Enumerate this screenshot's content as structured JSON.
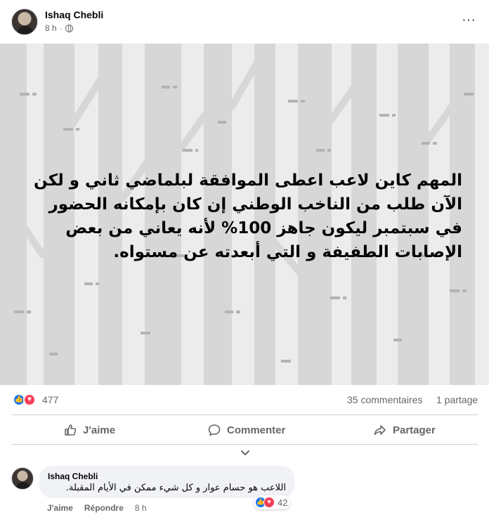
{
  "post": {
    "author": "Ishaq Chebli",
    "time": "8 h",
    "separator": "·",
    "more_icon": "⋯",
    "text": "المهم كاين لاعب اعطى الموافقة لبلماضي ثاني و لكن الآن طلب من الناخب الوطني إن كان بإمكانه الحضور في سبتمبر ليكون جاهز 100% لأنه يعاني من بعض الإصابات الطفيفة و التي أبعدته عن مستواه.",
    "background_colors": {
      "base": "#ececec",
      "trees": "#d6d6d6",
      "marks": "#ababab"
    }
  },
  "stats": {
    "reactions_count": "477",
    "comments": "35 commentaires",
    "shares": "1 partage"
  },
  "actions": {
    "like": "J'aime",
    "comment": "Commenter",
    "share": "Partager"
  },
  "comment": {
    "author": "Ishaq Chebli",
    "text": "اللاعب هو حسام عوار و كل شيء ممكن في الأيام المقبلة.",
    "like_label": "J'aime",
    "reply_label": "Répondre",
    "time": "8 h",
    "reactions_count": "42"
  },
  "colors": {
    "accent": "#1877f2",
    "love": "#f33e58",
    "secondary_text": "#65676b"
  },
  "icons": {
    "like": "like-icon",
    "love": "love-icon",
    "comment": "comment-icon",
    "share": "share-icon",
    "globe": "globe-icon",
    "more": "more-icon",
    "chevron": "chevron-down-icon"
  }
}
